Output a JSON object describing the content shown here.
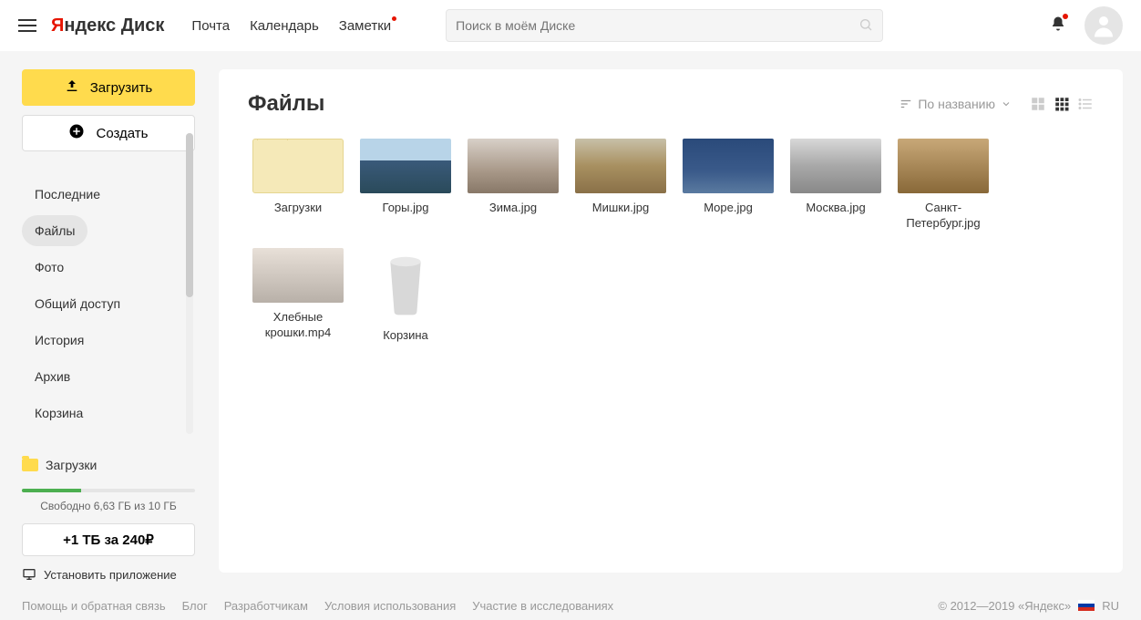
{
  "header": {
    "logo_prefix": "Я",
    "logo_rest": "ндекс",
    "logo_product": "Диск",
    "nav": [
      "Почта",
      "Календарь",
      "Заметки"
    ],
    "search_placeholder": "Поиск в моём Диске"
  },
  "sidebar": {
    "upload_label": "Загрузить",
    "create_label": "Создать",
    "items": [
      "Последние",
      "Файлы",
      "Фото",
      "Общий доступ",
      "История",
      "Архив",
      "Корзина"
    ],
    "active_index": 1,
    "tree": [
      "Загрузки"
    ],
    "storage_text": "Свободно 6,63 ГБ из 10 ГБ",
    "upgrade_label": "+1 ТБ за 240₽",
    "install_label": "Установить приложение"
  },
  "main": {
    "title": "Файлы",
    "sort_label": "По названию",
    "files": [
      {
        "name": "Загрузки",
        "type": "folder"
      },
      {
        "name": "Горы.jpg",
        "type": "image",
        "bg": "linear-gradient(to bottom,#b8d4e8 40%,#3a5a7a 40%,#2a4a5a)"
      },
      {
        "name": "Зима.jpg",
        "type": "image",
        "bg": "linear-gradient(to bottom,#d8d0c8,#a89888 60%,#887868)"
      },
      {
        "name": "Мишки.jpg",
        "type": "image",
        "bg": "linear-gradient(to bottom,#c8c0a8,#a89060 50%,#8a7048)"
      },
      {
        "name": "Море.jpg",
        "type": "image",
        "bg": "linear-gradient(to bottom,#2a4a7a,#3a5a8a 60%,#5a7aa0)"
      },
      {
        "name": "Москва.jpg",
        "type": "image",
        "bg": "linear-gradient(to bottom,#d8d8d8,#a8a8a8 50%,#888888)"
      },
      {
        "name": "Санкт-Петербург.jpg",
        "type": "image",
        "bg": "linear-gradient(to bottom,#c8a878,#a88858 50%,#886838)"
      },
      {
        "name": "Хлебные крошки.mp4",
        "type": "image",
        "bg": "linear-gradient(to bottom,#e8e0d8,#d0c8c0 50%,#b8b0a8)"
      },
      {
        "name": "Корзина",
        "type": "trash"
      }
    ]
  },
  "footer": {
    "links": [
      "Помощь и обратная связь",
      "Блог",
      "Разработчикам",
      "Условия использования",
      "Участие в исследованиях"
    ],
    "copyright": "© 2012—2019  «Яндекс»",
    "lang": "RU"
  }
}
